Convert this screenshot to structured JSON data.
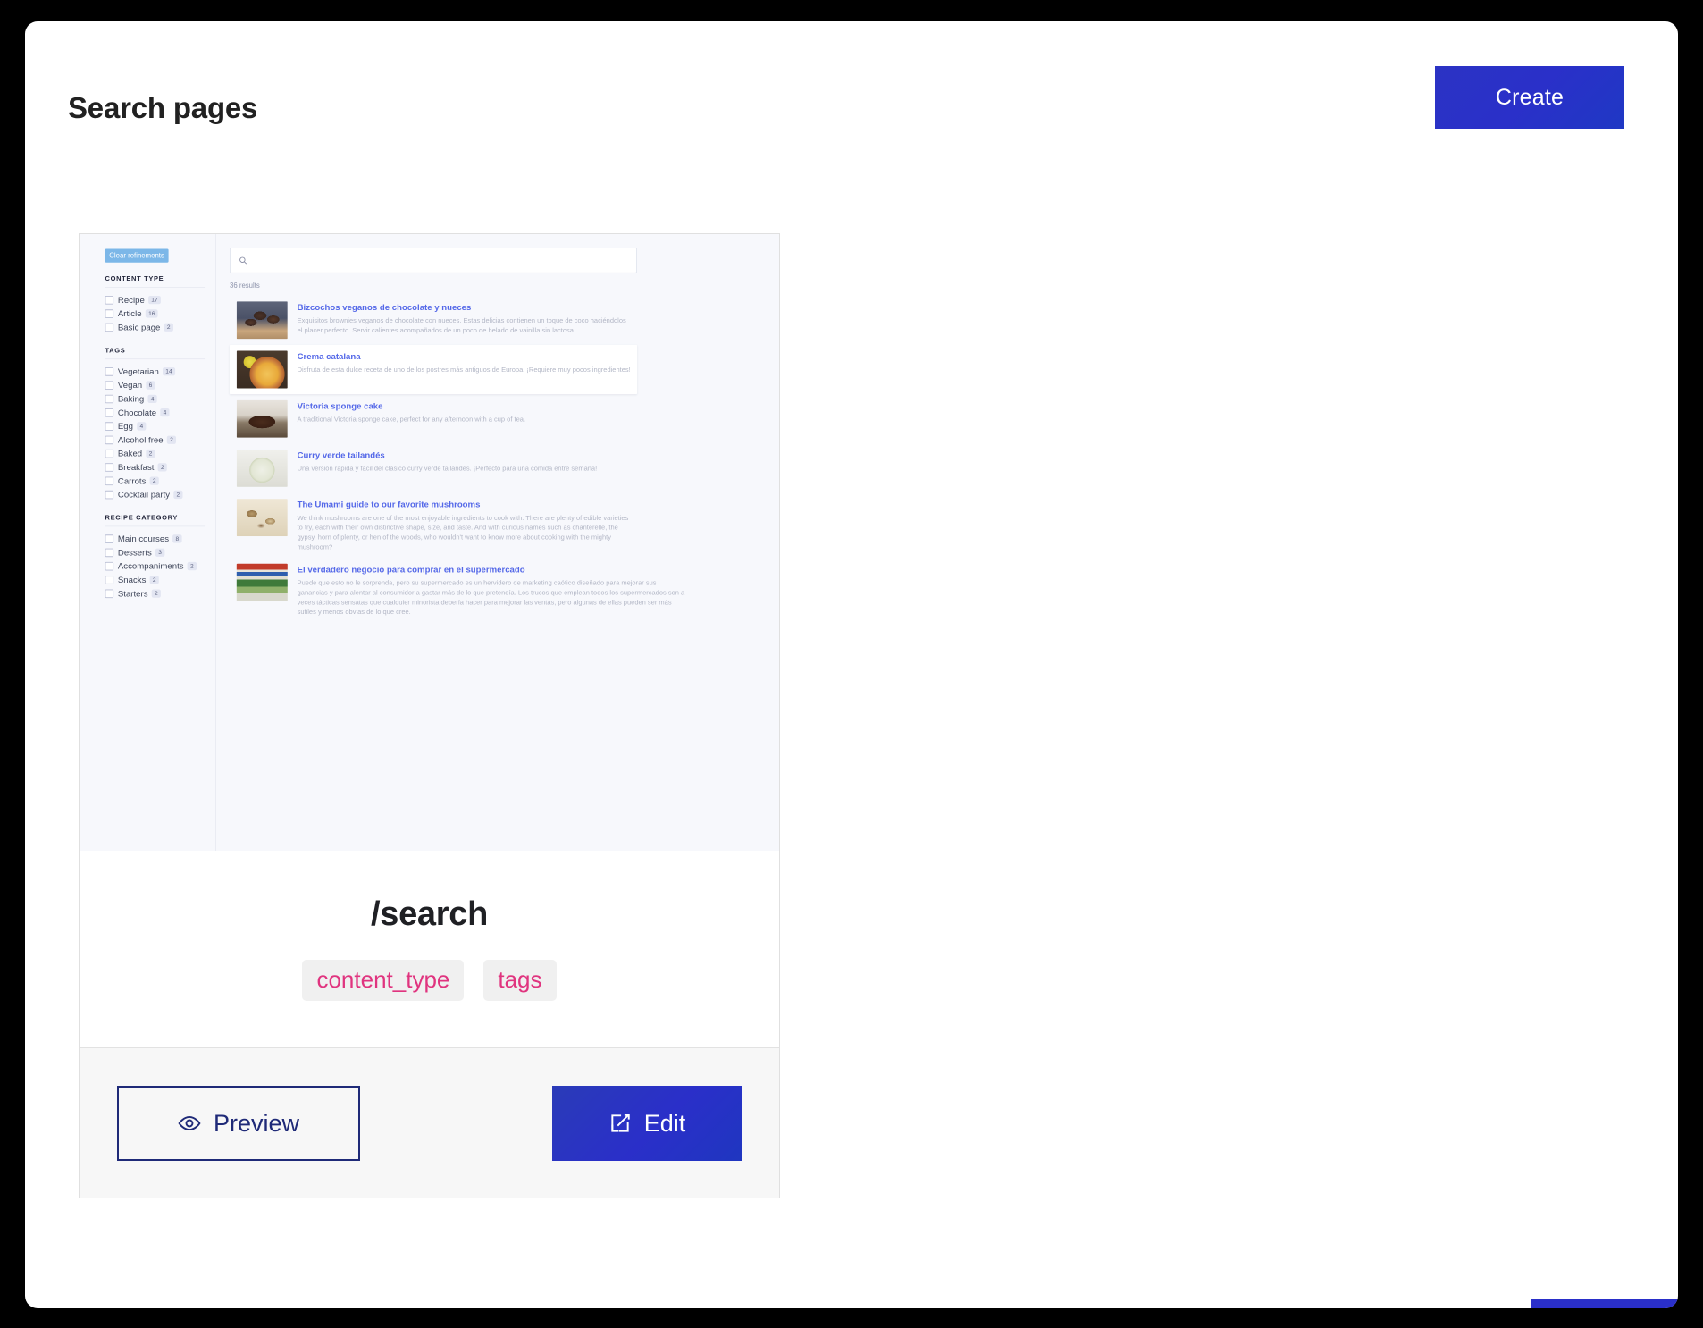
{
  "header": {
    "title": "Search pages",
    "create_label": "Create"
  },
  "preview": {
    "sidebar": {
      "clear_refinements_label": "Clear refinements",
      "groups": [
        {
          "title": "CONTENT TYPE",
          "items": [
            {
              "label": "Recipe",
              "count": "17"
            },
            {
              "label": "Article",
              "count": "16"
            },
            {
              "label": "Basic page",
              "count": "2"
            }
          ]
        },
        {
          "title": "TAGS",
          "items": [
            {
              "label": "Vegetarian",
              "count": "14"
            },
            {
              "label": "Vegan",
              "count": "6"
            },
            {
              "label": "Baking",
              "count": "4"
            },
            {
              "label": "Chocolate",
              "count": "4"
            },
            {
              "label": "Egg",
              "count": "4"
            },
            {
              "label": "Alcohol free",
              "count": "2"
            },
            {
              "label": "Baked",
              "count": "2"
            },
            {
              "label": "Breakfast",
              "count": "2"
            },
            {
              "label": "Carrots",
              "count": "2"
            },
            {
              "label": "Cocktail party",
              "count": "2"
            }
          ]
        },
        {
          "title": "RECIPE CATEGORY",
          "items": [
            {
              "label": "Main courses",
              "count": "8"
            },
            {
              "label": "Desserts",
              "count": "3"
            },
            {
              "label": "Accompaniments",
              "count": "2"
            },
            {
              "label": "Snacks",
              "count": "2"
            },
            {
              "label": "Starters",
              "count": "2"
            }
          ]
        }
      ]
    },
    "search": {
      "value": "",
      "placeholder": "",
      "icon": "search-icon"
    },
    "results_count": "36 results",
    "results": [
      {
        "title": "Bizcochos veganos de chocolate y nueces",
        "description": "Exquisitos brownies veganos de chocolate con nueces. Estas delicias contienen un toque de coco haciéndolos el placer perfecto. Servir calientes acompañados de un poco de helado de vainilla sin lactosa.",
        "thumb": "brownies-thumbnail"
      },
      {
        "title": "Crema catalana",
        "description": "Disfruta de esta dulce receta de uno de los postres más antiguos de Europa. ¡Requiere muy pocos ingredientes!",
        "thumb": "crema-catalana-thumbnail"
      },
      {
        "title": "Victoria sponge cake",
        "description": "A traditional Victoria sponge cake, perfect for any afternoon with a cup of tea.",
        "thumb": "victoria-sponge-thumbnail"
      },
      {
        "title": "Curry verde tailandés",
        "description": "Una versión rápida y fácil del clásico curry verde tailandés. ¡Perfecto para una comida entre semana!",
        "thumb": "curry-thumbnail"
      },
      {
        "title": "The Umami guide to our favorite mushrooms",
        "description": "We think mushrooms are one of the most enjoyable ingredients to cook with. There are plenty of edible varieties to try, each with their own distinctive shape, size, and taste. And with curious names such as chanterelle, the gypsy, horn of plenty, or hen of the woods, who wouldn't want to know more about cooking with the mighty mushroom?",
        "thumb": "mushrooms-thumbnail"
      },
      {
        "title": "El verdadero negocio para comprar en el supermercado",
        "description": "Puede que esto no le sorprenda, pero su supermercado es un hervidero de marketing caótico diseñado para mejorar sus ganancias y para alentar al consumidor a gastar más de lo que pretendía. Los trucos que emplean todos los supermercados son a veces tácticas sensatas que cualquier minorista debería hacer para mejorar las ventas, pero algunas de ellas pueden ser más sutiles y menos obvias de lo que cree.",
        "thumb": "supermarket-thumbnail"
      }
    ]
  },
  "card": {
    "route": "/search",
    "facets": [
      "content_type",
      "tags"
    ],
    "preview_label": "Preview",
    "edit_label": "Edit"
  },
  "colors": {
    "accent": "#2a2fc9",
    "link": "#5468e8",
    "facet_chip_text": "#e0347f",
    "clear_refinements_bg": "#7cb7e8",
    "outline_button_border": "#1f2a78"
  }
}
